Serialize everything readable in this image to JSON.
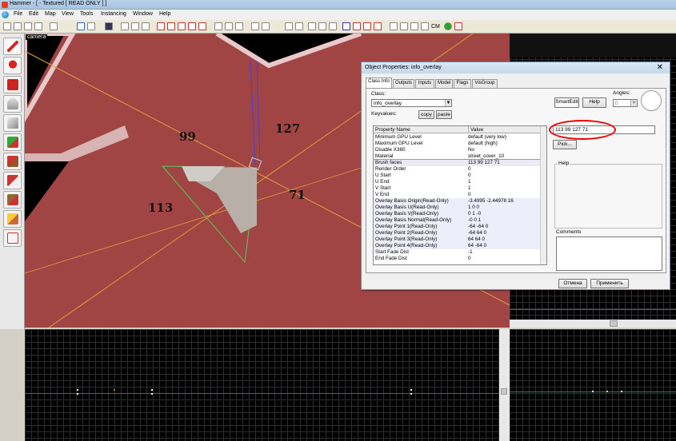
{
  "window": {
    "title": "Hammer - [ - Textured [ READ ONLY ] ]"
  },
  "menu": [
    "File",
    "Edit",
    "Map",
    "View",
    "Tools",
    "Instancing",
    "Window",
    "Help"
  ],
  "toolbar": {
    "icons": [
      "grid-icon",
      "grid-small-icon",
      "grid-large-icon",
      "snap-icon",
      "undo-icon",
      "redo-icon",
      "texture-icon",
      "carve-icon",
      "hollow-icon",
      "group-icon",
      "ungroup-icon",
      "cut-icon",
      "copy-icon",
      "paste-icon",
      "cube-icon",
      "wire-icon",
      "select-icon",
      "entity-icon",
      "texture-apply-icon",
      "cordon-icon",
      "run-map-icon",
      "cm-icon",
      "check-icon",
      "visgroup-icon"
    ],
    "cm_label": "CM"
  },
  "toolbox": [
    "selection-tool-icon",
    "magnify-tool-icon",
    "camera-tool-icon",
    "entity-tool-icon",
    "block-tool-icon",
    "texture-tool-icon",
    "apply-texture-icon",
    "decal-tool-icon",
    "overlay-tool-icon",
    "clip-tool-icon",
    "vertex-tool-icon"
  ],
  "viewport": {
    "label": "camera",
    "numbers": {
      "top_left": "99",
      "top_right": "127",
      "left": "113",
      "right": "71"
    }
  },
  "dialog": {
    "title": "Object Properties: info_overlay",
    "tabs": [
      "Class Info",
      "Outputs",
      "Inputs",
      "Model",
      "Flags",
      "VisGroup"
    ],
    "class_label": "Class:",
    "class_value": "info_overlay",
    "keyvalues_label": "Keyvalues:",
    "copy_label": "copy",
    "paste_label": "paste",
    "smartedit_label": "SmartEdit",
    "help_button": "Help",
    "angles_label": "Angles:",
    "angles_value": "0",
    "table_header": {
      "name": "Property Name",
      "value": "Value"
    },
    "properties": [
      {
        "name": "Minimum GPU Level",
        "value": "default (very low)"
      },
      {
        "name": "Maximum GPU Level",
        "value": "default (high)"
      },
      {
        "name": "Disable X360",
        "value": "No"
      },
      {
        "name": "Material",
        "value": "street_cover_10"
      },
      {
        "name": "Brush faces",
        "value": "113 99 127 71"
      },
      {
        "name": "Render Order",
        "value": "0"
      },
      {
        "name": "U Start",
        "value": "0"
      },
      {
        "name": "U End",
        "value": "1"
      },
      {
        "name": "V Start",
        "value": "1"
      },
      {
        "name": "V End",
        "value": "0"
      },
      {
        "name": "Overlay Basis Origin(Read-Only)",
        "value": "-3.4995 -2.44978 16"
      },
      {
        "name": "Overlay Basis U(Read-Only)",
        "value": "1 0 0"
      },
      {
        "name": "Overlay Basis V(Read-Only)",
        "value": "0 1 -0"
      },
      {
        "name": "Overlay Basis Normal(Read-Only)",
        "value": "-0 0 1"
      },
      {
        "name": "Overlay Point 1(Read-Only)",
        "value": "-64 -64 0"
      },
      {
        "name": "Overlay Point 2(Read-Only)",
        "value": "-64 64 0"
      },
      {
        "name": "Overlay Point 3(Read-Only)",
        "value": "64 64 0"
      },
      {
        "name": "Overlay Point 4(Read-Only)",
        "value": "64 -64 0"
      },
      {
        "name": "Start Fade Dist",
        "value": "-1"
      },
      {
        "name": "End Fade Dist",
        "value": "0"
      }
    ],
    "edit_value": "113 99 127 71",
    "pick_button": "Pick...",
    "help_group": "Help",
    "comments_group": "Comments",
    "cancel_button": "Отмена",
    "apply_button": "Применить"
  },
  "colors": {
    "floor": "#a04444",
    "grid_line": "#1d7a6a",
    "highlight": "#e00000"
  }
}
